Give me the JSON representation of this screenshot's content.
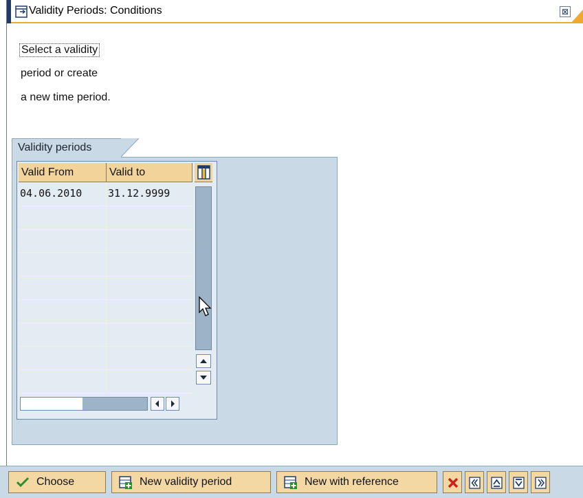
{
  "window": {
    "title": "Validity Periods: Conditions",
    "close_label": "⊠"
  },
  "instructions": {
    "line1": "Select a validity",
    "line2": "period or create",
    "line3": "a new time period."
  },
  "group": {
    "title": "Validity periods"
  },
  "table": {
    "columns": [
      "Valid From",
      "Valid to"
    ],
    "rows": [
      {
        "valid_from": "04.06.2010",
        "valid_to": "31.12.9999"
      }
    ],
    "empty_rows": 8
  },
  "toolbar": {
    "choose_label": "Choose",
    "new_period_label": "New validity period",
    "new_ref_label": "New with reference",
    "icon_buttons": [
      "cancel-icon",
      "previous-icon",
      "next-icon",
      "first-icon",
      "last-icon"
    ]
  },
  "colors": {
    "accent_orange": "#f0a830",
    "header_bg": "#f2d49a",
    "panel_bg": "#cad9e6",
    "cancel_red": "#d0201a",
    "check_green": "#2e8a2e"
  }
}
